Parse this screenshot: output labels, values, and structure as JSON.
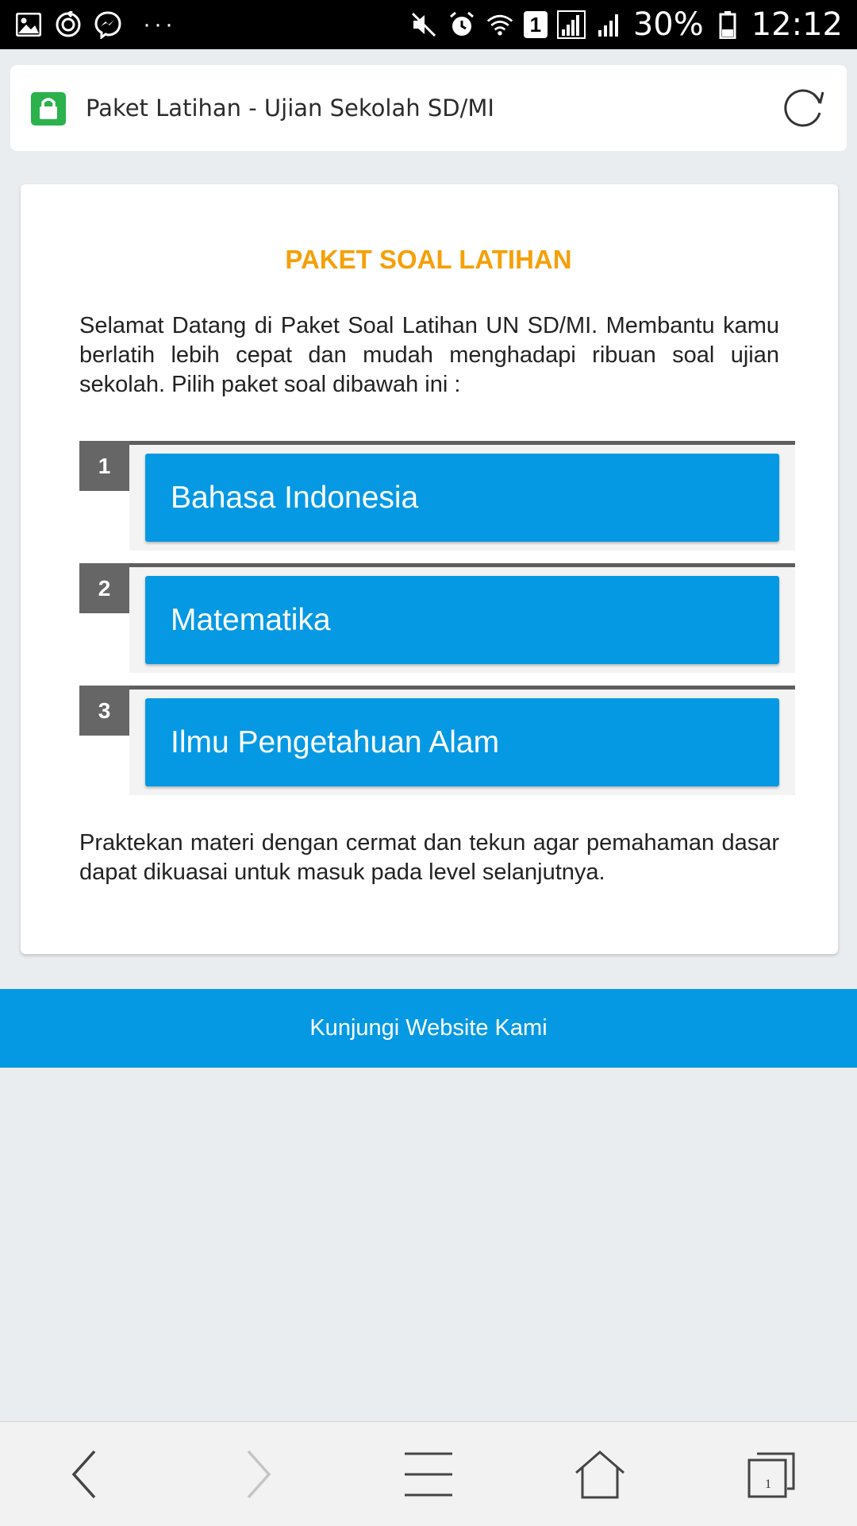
{
  "status_bar": {
    "battery_percent": "30%",
    "time": "12:12",
    "sim_label": "1",
    "more_dots": "···",
    "left_icons": [
      "gallery-icon",
      "sync-icon",
      "messenger-icon"
    ],
    "right_icons": [
      "mute-icon",
      "alarm-icon",
      "wifi-icon",
      "sim-icon",
      "signal-icon",
      "signal-icon",
      "battery-icon"
    ]
  },
  "browser": {
    "page_title": "Paket Latihan - Ujian Sekolah SD/MI",
    "lock_color": "#2bb24c"
  },
  "card": {
    "title": "PAKET SOAL LATIHAN",
    "intro": "Selamat Datang di Paket Soal Latihan UN SD/MI. Membantu kamu berlatih lebih cepat dan mudah menghadapi ribuan soal ujian sekolah. Pilih paket soal dibawah ini :",
    "items": [
      {
        "number": "1",
        "label": "Bahasa Indonesia"
      },
      {
        "number": "2",
        "label": "Matematika"
      },
      {
        "number": "3",
        "label": "Ilmu Pengetahuan Alam"
      }
    ],
    "outro": "Praktekan materi dengan cermat dan tekun agar pemahaman dasar dapat dikuasai untuk masuk pada level selanjutnya."
  },
  "banner": {
    "label": "Kunjungi Website Kami"
  },
  "bottom_nav": {
    "tab_count": "1",
    "buttons": [
      "back-icon",
      "forward-icon",
      "menu-icon",
      "home-icon",
      "tabs-icon"
    ]
  },
  "colors": {
    "accent_blue": "#0699e3",
    "title_orange": "#f5a00a",
    "number_gray": "#666666"
  }
}
